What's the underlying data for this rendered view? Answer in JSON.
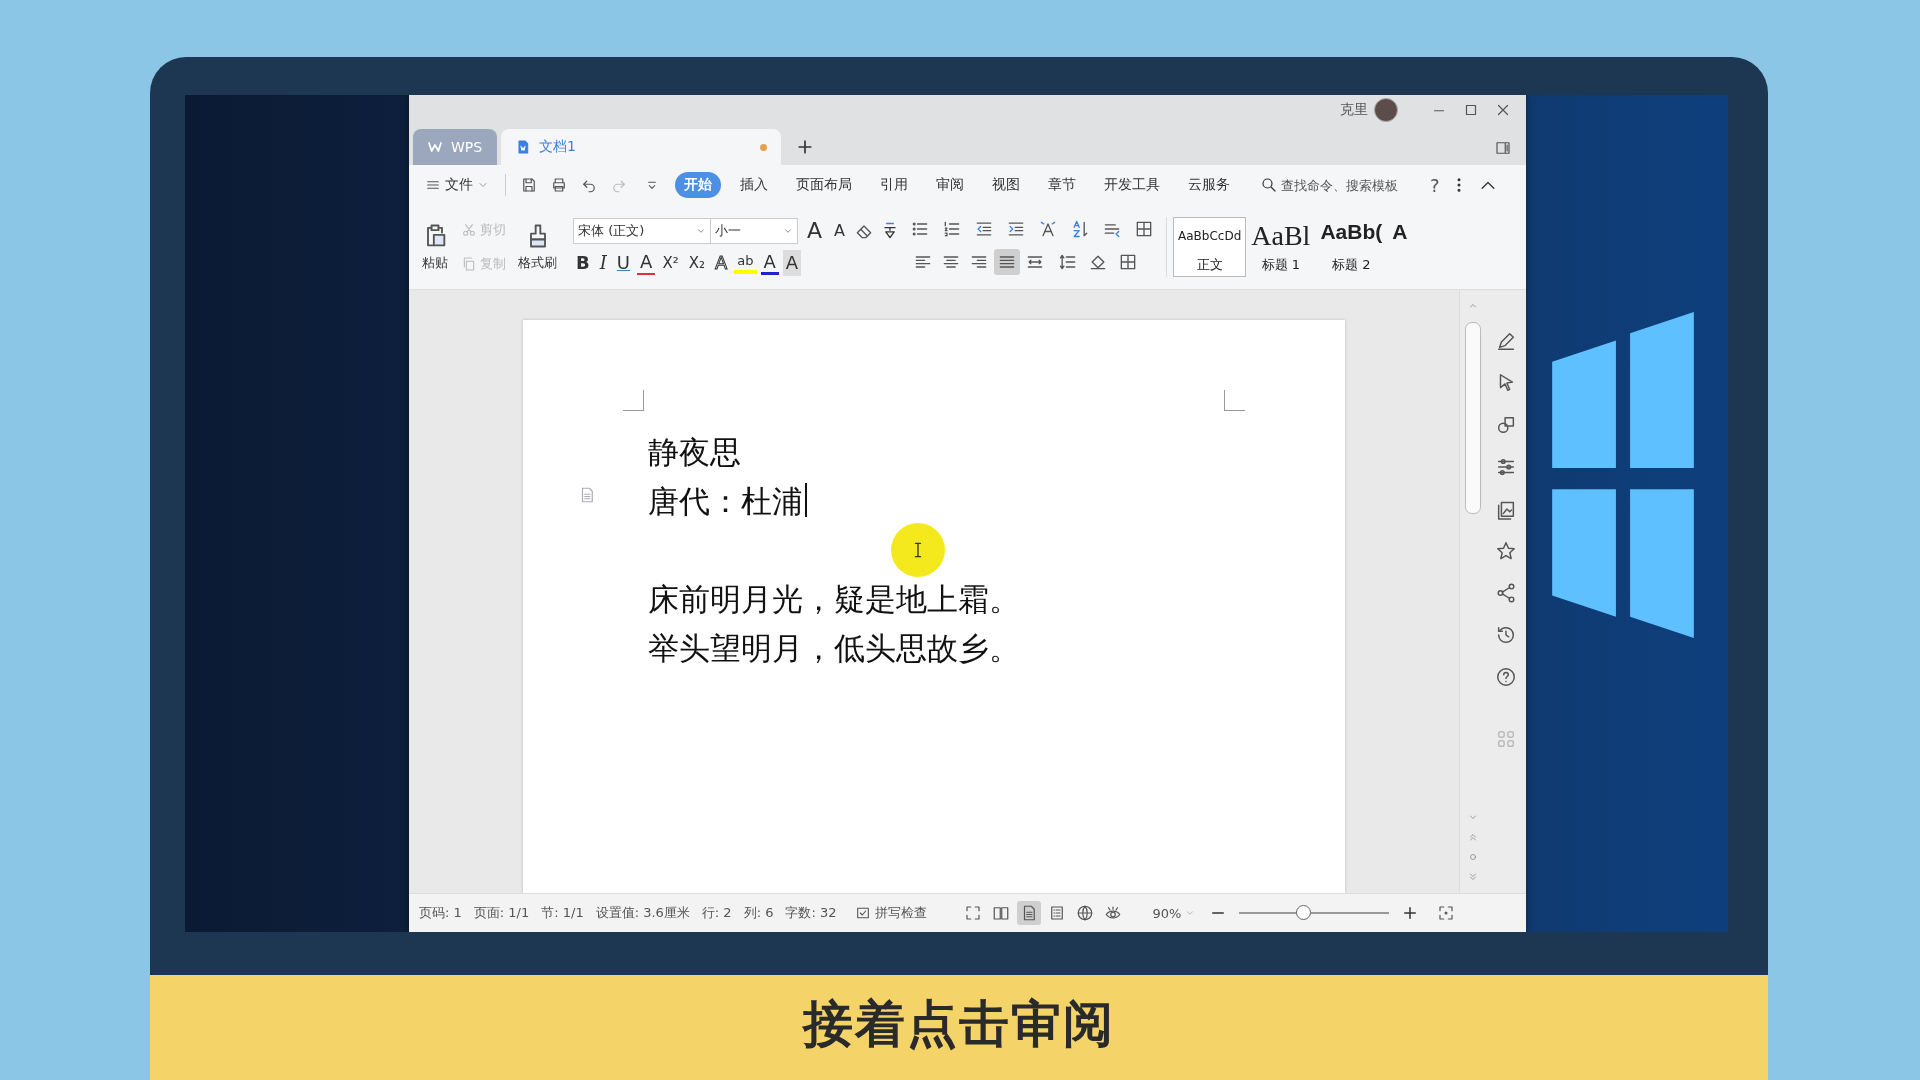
{
  "window": {
    "tabs": [
      {
        "label": "WPS",
        "kind": "home",
        "selected": false
      },
      {
        "label": "文档1",
        "kind": "document",
        "selected": true,
        "unsaved": true
      }
    ],
    "user": {
      "name": "克里"
    }
  },
  "menu": {
    "file": "文件",
    "tabs": [
      {
        "label": "开始",
        "selected": true
      },
      {
        "label": "插入",
        "selected": false
      },
      {
        "label": "页面布局",
        "selected": false
      },
      {
        "label": "引用",
        "selected": false
      },
      {
        "label": "审阅",
        "selected": false
      },
      {
        "label": "视图",
        "selected": false
      },
      {
        "label": "章节",
        "selected": false
      },
      {
        "label": "开发工具",
        "selected": false
      },
      {
        "label": "云服务",
        "selected": false
      }
    ],
    "search": {
      "placeholder": "查找命令、搜索模板"
    },
    "help": "?"
  },
  "ribbon": {
    "clipboard": [
      {
        "kind": "paste",
        "label": "粘贴",
        "disabled": false
      },
      {
        "kind": "cut",
        "label": "剪切",
        "disabled": true
      },
      {
        "kind": "copy",
        "label": "复制",
        "disabled": true
      },
      {
        "kind": "painter",
        "label": "格式刷",
        "disabled": false
      }
    ],
    "font": {
      "value": "宋体 (正文)"
    },
    "size": {
      "value": "小一"
    },
    "size_buttons": [
      {
        "kind": "grow",
        "label": "A"
      },
      {
        "kind": "shrink",
        "label": "A"
      }
    ],
    "format_buttons": [
      {
        "kind": "bold",
        "label": "B"
      },
      {
        "kind": "italic",
        "label": "I"
      },
      {
        "kind": "underline",
        "label": "U"
      },
      {
        "kind": "strike",
        "label": "A"
      },
      {
        "kind": "sup",
        "label": "X²"
      },
      {
        "kind": "sub",
        "label": "X₂"
      },
      {
        "kind": "effect",
        "label": "A"
      },
      {
        "kind": "highlight",
        "label": "ab"
      },
      {
        "kind": "color",
        "label": "A"
      },
      {
        "kind": "shade",
        "label": "A"
      }
    ],
    "alignment": [
      {
        "kind": "left",
        "selected": false
      },
      {
        "kind": "center",
        "selected": false
      },
      {
        "kind": "right",
        "selected": false
      },
      {
        "kind": "justify",
        "selected": true
      },
      {
        "kind": "distributed",
        "selected": false
      }
    ],
    "styles": [
      {
        "sample": "AaBbCcDd",
        "label": "正文",
        "kind": "body",
        "selected": true
      },
      {
        "sample": "AaBl",
        "label": "标题 1",
        "kind": "heading1",
        "selected": false
      },
      {
        "sample": "AaBb(",
        "label": "标题 2",
        "kind": "heading2",
        "selected": false
      },
      {
        "sample": "A",
        "kind": "heading3",
        "selected": false
      }
    ]
  },
  "document": {
    "lines": [
      {
        "text": "静夜思",
        "space_before": false,
        "cursor": false
      },
      {
        "text": "唐代：杜浦",
        "space_before": false,
        "cursor": true
      },
      {
        "text": "床前明月光，疑是地上霜。",
        "space_before": true,
        "cursor": false
      },
      {
        "text": "举头望明月，低头思故乡。",
        "space_before": false,
        "cursor": false
      }
    ]
  },
  "status": {
    "items": [
      "页码: 1",
      "页面: 1/1",
      "节: 1/1",
      "设置值: 3.6厘米",
      "行: 2",
      "列: 6",
      "字数: 32"
    ],
    "spell_check": "拼写检查",
    "views": [
      {
        "kind": "fullscreen",
        "selected": false
      },
      {
        "kind": "reading",
        "selected": false
      },
      {
        "kind": "page",
        "selected": true
      },
      {
        "kind": "outline",
        "selected": false
      },
      {
        "kind": "web",
        "selected": false
      },
      {
        "kind": "eye",
        "selected": false
      }
    ],
    "zoom": {
      "value": "90%",
      "level": 0.42
    }
  },
  "subtitle": "接着点击审阅"
}
